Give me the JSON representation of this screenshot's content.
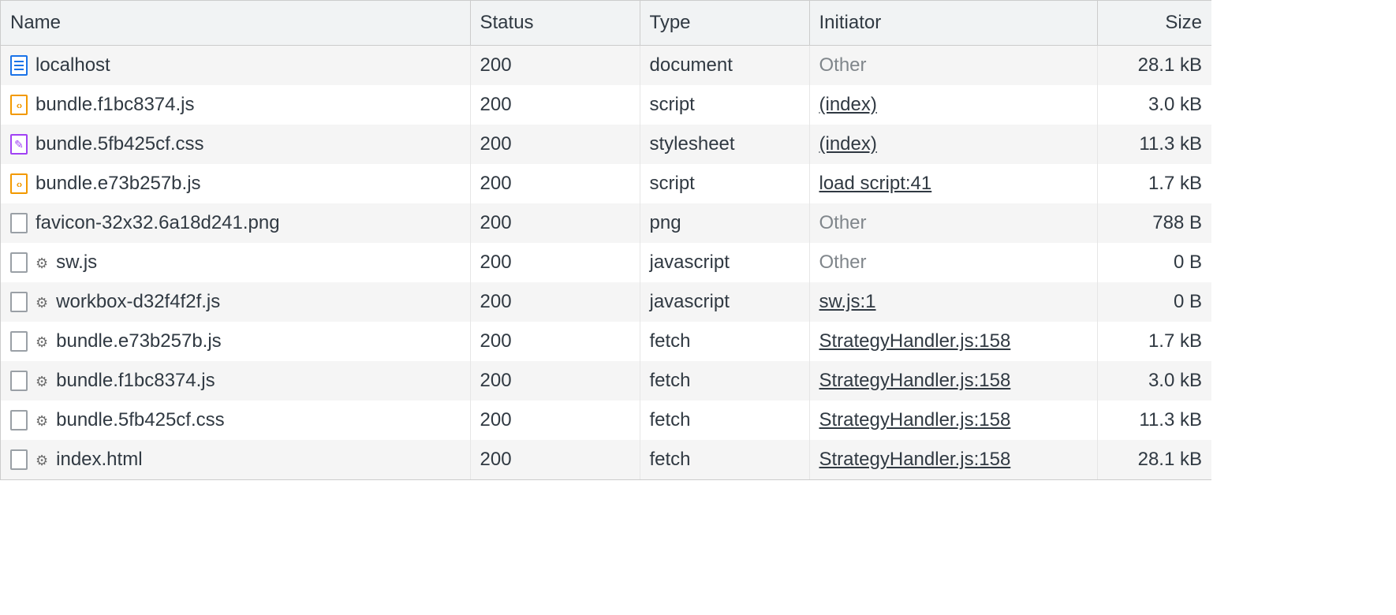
{
  "columns": {
    "name": "Name",
    "status": "Status",
    "type": "Type",
    "initiator": "Initiator",
    "size": "Size"
  },
  "rows": [
    {
      "icon": "document",
      "gear": false,
      "name": "localhost",
      "status": "200",
      "type": "document",
      "initiator": "Other",
      "initiator_link": false,
      "size": "28.1 kB"
    },
    {
      "icon": "js",
      "gear": false,
      "name": "bundle.f1bc8374.js",
      "status": "200",
      "type": "script",
      "initiator": "(index)",
      "initiator_link": true,
      "size": "3.0 kB"
    },
    {
      "icon": "css",
      "gear": false,
      "name": "bundle.5fb425cf.css",
      "status": "200",
      "type": "stylesheet",
      "initiator": "(index)",
      "initiator_link": true,
      "size": "11.3 kB"
    },
    {
      "icon": "js",
      "gear": false,
      "name": "bundle.e73b257b.js",
      "status": "200",
      "type": "script",
      "initiator": "load script:41",
      "initiator_link": true,
      "size": "1.7 kB"
    },
    {
      "icon": "generic",
      "gear": false,
      "name": "favicon-32x32.6a18d241.png",
      "status": "200",
      "type": "png",
      "initiator": "Other",
      "initiator_link": false,
      "size": "788 B"
    },
    {
      "icon": "generic",
      "gear": true,
      "name": "sw.js",
      "status": "200",
      "type": "javascript",
      "initiator": "Other",
      "initiator_link": false,
      "size": "0 B"
    },
    {
      "icon": "generic",
      "gear": true,
      "name": "workbox-d32f4f2f.js",
      "status": "200",
      "type": "javascript",
      "initiator": "sw.js:1",
      "initiator_link": true,
      "size": "0 B"
    },
    {
      "icon": "generic",
      "gear": true,
      "name": "bundle.e73b257b.js",
      "status": "200",
      "type": "fetch",
      "initiator": "StrategyHandler.js:158",
      "initiator_link": true,
      "size": "1.7 kB"
    },
    {
      "icon": "generic",
      "gear": true,
      "name": "bundle.f1bc8374.js",
      "status": "200",
      "type": "fetch",
      "initiator": "StrategyHandler.js:158",
      "initiator_link": true,
      "size": "3.0 kB"
    },
    {
      "icon": "generic",
      "gear": true,
      "name": "bundle.5fb425cf.css",
      "status": "200",
      "type": "fetch",
      "initiator": "StrategyHandler.js:158",
      "initiator_link": true,
      "size": "11.3 kB"
    },
    {
      "icon": "generic",
      "gear": true,
      "name": "index.html",
      "status": "200",
      "type": "fetch",
      "initiator": "StrategyHandler.js:158",
      "initiator_link": true,
      "size": "28.1 kB"
    }
  ]
}
